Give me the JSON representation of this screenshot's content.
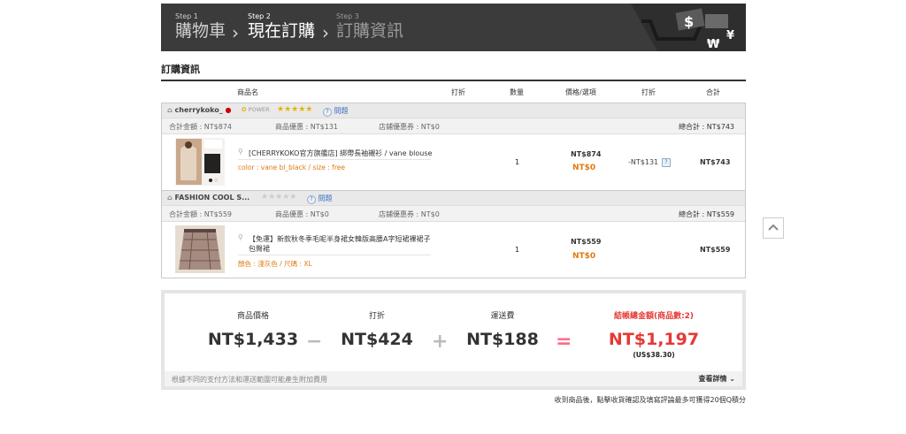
{
  "steps": [
    {
      "num": "Step 1",
      "title": "購物車"
    },
    {
      "num": "Step 2",
      "title": "現在訂購"
    },
    {
      "num": "Step 3",
      "title": "訂購資訊"
    }
  ],
  "section_title": "訂購資訊",
  "columns": {
    "name": "商品名",
    "discount": "打折",
    "qty": "數量",
    "price": "價格/選項",
    "discount2": "打折",
    "total": "合計"
  },
  "stores": [
    {
      "name": "cherrykoko_",
      "power": "POWER",
      "qa": "問題",
      "sum_label": "合計金額 : NT$874",
      "prod_disc": "商品優惠 : NT$131",
      "store_coupon": "店鋪優惠券 : NT$0",
      "grand": "總合計 : NT$743",
      "item": {
        "name": "[CHERRYKOKO官方旗艦店] 綁帶長袖襯衫 / vane blouse",
        "option": "color : vane bl_black / size : free",
        "qty": "1",
        "price": "NT$874",
        "final": "NT$0",
        "discount": "-NT$131",
        "total": "NT$743"
      }
    },
    {
      "name": "FASHION COOL S...",
      "qa": "問題",
      "sum_label": "合計金額 : NT$559",
      "prod_disc": "商品優惠 : NT$0",
      "store_coupon": "店鋪優惠券 : NT$0",
      "grand": "總合計 : NT$559",
      "item": {
        "name": "【免運】新款秋冬季毛呢半身裙女韓版高腰A字短裙裸裙子包臀裙",
        "option": "顏色 : 淺灰色 / 尺碼 : XL",
        "qty": "1",
        "price": "NT$559",
        "final": "NT$0",
        "discount": "",
        "total": "NT$559"
      }
    }
  ],
  "summary": {
    "price_label": "商品價格",
    "price": "NT$1,433",
    "disc_label": "打折",
    "disc": "NT$424",
    "ship_label": "運送費",
    "ship": "NT$188",
    "total_label": "結帳總金額(商品數:2)",
    "total": "NT$1,197",
    "usd": "(US$38.30)",
    "footnote": "根據不同的支付方法和運送範圍可能產生附加費用",
    "details": "查看詳情"
  },
  "note": "收到商品後，點擊收貨確認及填寫評論最多可獲得20個Q積分",
  "colors": {
    "accent": "#e53935",
    "orange": "#e07a10",
    "header": "#3b3b3b"
  }
}
